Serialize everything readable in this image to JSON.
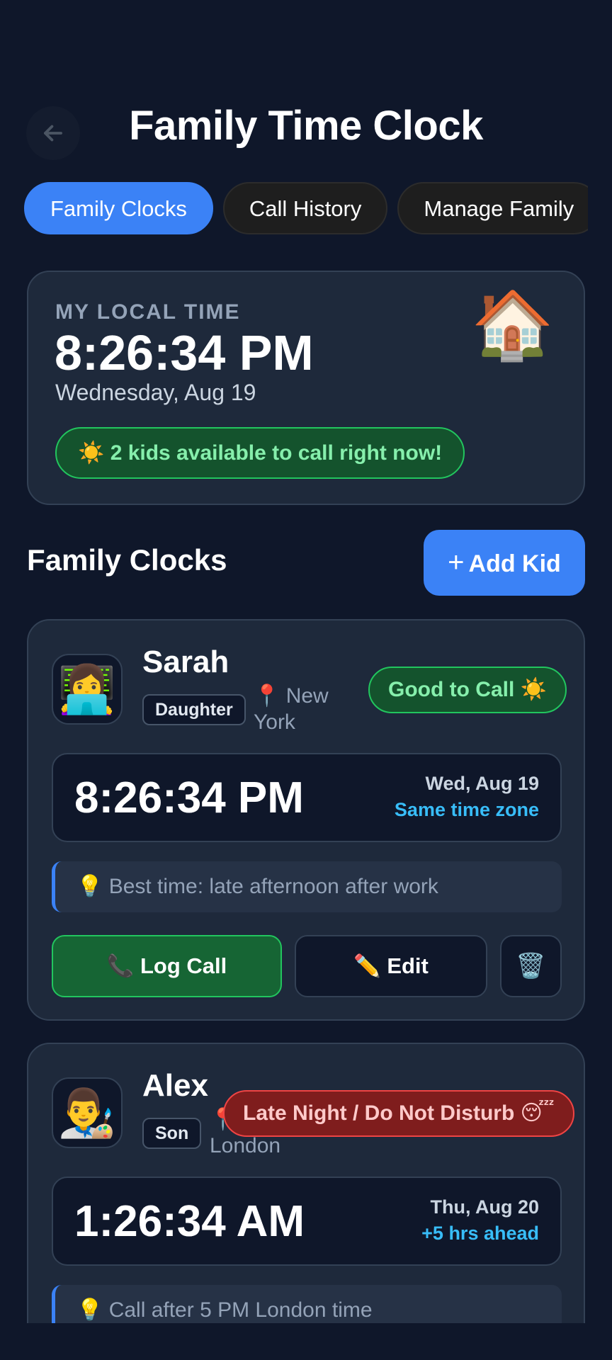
{
  "header": {
    "title": "Family Time Clock",
    "back_icon": "arrow-left-icon"
  },
  "tabs": [
    {
      "label": "Family Clocks",
      "active": true
    },
    {
      "label": "Call History",
      "active": false
    },
    {
      "label": "Manage Family",
      "active": false
    }
  ],
  "local": {
    "label": "MY LOCAL TIME",
    "time": "8:26:34 PM",
    "date": "Wednesday, Aug 19",
    "icon": "🏠",
    "availability": "☀️ 2 kids available to call right now!"
  },
  "section": {
    "title": "Family Clocks",
    "add_label": "Add Kid",
    "add_icon": "+"
  },
  "kids": [
    {
      "avatar": "👩‍💻",
      "name": "Sarah",
      "relation": "Daughter",
      "location_pin": "📍",
      "location_line1": "New",
      "location_line2": "York",
      "status": "Good to Call ☀️",
      "time": "8:26:34 PM",
      "date": "Wed, Aug 19",
      "offset": "Same time zone",
      "tip": "💡 Best time: late afternoon after work",
      "log_label": "📞 Log Call",
      "edit_label": "✏️ Edit",
      "delete_icon": "🗑️"
    },
    {
      "avatar": "👨‍🎨",
      "name": "Alex",
      "relation": "Son",
      "location_pin": "📍",
      "location_line2": "London",
      "status": "Late Night / Do Not Disturb 😴",
      "time": "1:26:34 AM",
      "date": "Thu, Aug 20",
      "offset": "+5 hrs ahead",
      "tip": "💡 Call after 5 PM London time"
    }
  ],
  "colors": {
    "background": "#0f172a",
    "card": "#1e293b",
    "accent": "#3b82f6",
    "good": "#22c55e",
    "bad": "#ef4444",
    "offset": "#38bdf8"
  }
}
